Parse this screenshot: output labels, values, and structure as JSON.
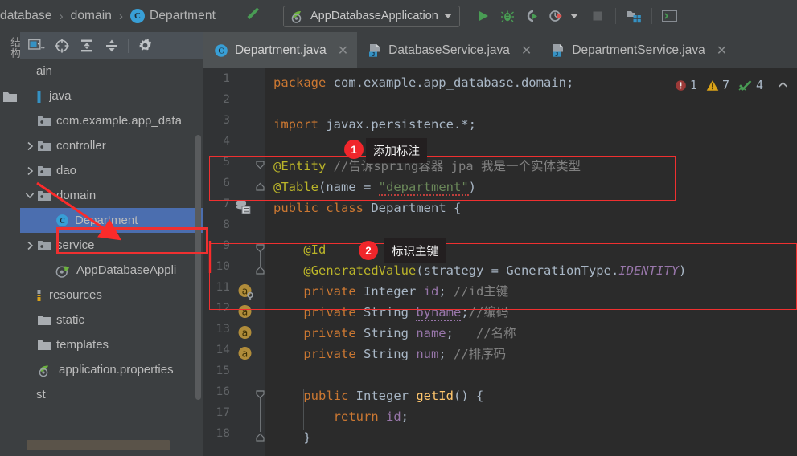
{
  "toolbar": {
    "breadcrumbs": [
      {
        "label": "database",
        "icon": "none"
      },
      {
        "label": "domain",
        "icon": "none"
      },
      {
        "label": "Department",
        "icon": "class-icon"
      }
    ],
    "separator": "›",
    "build_icon": "hammer-icon",
    "run_config": {
      "label": "AppDatabaseApplication",
      "icon": "spring-boot-icon"
    },
    "buttons": [
      {
        "name": "run-button",
        "icon": "play-icon"
      },
      {
        "name": "debug-button",
        "icon": "bug-icon"
      },
      {
        "name": "run-with-coverage-button",
        "icon": "coverage-icon"
      },
      {
        "name": "profiler-button",
        "icon": "profile-icon"
      },
      {
        "name": "stop-button",
        "icon": "stop-icon"
      },
      {
        "name": "project-structure-button",
        "icon": "project-structure-icon"
      },
      {
        "name": "terminal-button",
        "icon": "terminal-icon"
      }
    ]
  },
  "tool_window_tabs": {
    "structure_label": "结构",
    "project_icon": "folder-icon"
  },
  "project": {
    "toolbar_buttons": [
      {
        "name": "select-opened-file",
        "icon": "window-select-icon"
      },
      {
        "name": "locate-target",
        "icon": "crosshair-icon"
      },
      {
        "name": "expand-all",
        "icon": "expand-all-icon"
      },
      {
        "name": "collapse-all",
        "icon": "collapse-all-icon"
      },
      {
        "name": "settings",
        "icon": "gear-icon"
      }
    ],
    "tree": [
      {
        "label": "ain",
        "indent": 0,
        "twist": "",
        "icon": "none",
        "selected": false
      },
      {
        "label": "java",
        "indent": 0,
        "twist": "",
        "icon": "source-root-icon",
        "selected": false
      },
      {
        "label": "com.example.app_data",
        "indent": 1,
        "twist": "",
        "icon": "package-icon",
        "selected": false
      },
      {
        "label": "controller",
        "indent": 1,
        "twist": "right",
        "icon": "package-icon",
        "selected": false
      },
      {
        "label": "dao",
        "indent": 1,
        "twist": "right",
        "icon": "package-icon",
        "selected": false
      },
      {
        "label": "domain",
        "indent": 1,
        "twist": "down",
        "icon": "package-icon",
        "selected": false
      },
      {
        "label": "Department",
        "indent": 2,
        "twist": "",
        "icon": "class-icon",
        "selected": true
      },
      {
        "label": "service",
        "indent": 1,
        "twist": "right",
        "icon": "package-icon",
        "selected": false
      },
      {
        "label": "AppDatabaseAppli",
        "indent": 2,
        "twist": "",
        "icon": "spring-class-icon",
        "selected": false
      },
      {
        "label": "resources",
        "indent": 0,
        "twist": "",
        "icon": "resource-root-icon",
        "selected": false
      },
      {
        "label": "static",
        "indent": 1,
        "twist": "",
        "icon": "folder-icon",
        "selected": false
      },
      {
        "label": "templates",
        "indent": 1,
        "twist": "",
        "icon": "folder-icon",
        "selected": false
      },
      {
        "label": "application.properties",
        "indent": 1,
        "twist": "",
        "icon": "spring-prop-icon",
        "selected": false
      },
      {
        "label": "st",
        "indent": 0,
        "twist": "",
        "icon": "none",
        "selected": false
      }
    ]
  },
  "editor_tabs": [
    {
      "label": "Department.java",
      "icon": "class-icon",
      "active": true,
      "close": "✕"
    },
    {
      "label": "DatabaseService.java",
      "icon": "java-icon",
      "active": false,
      "close": "✕"
    },
    {
      "label": "DepartmentService.java",
      "icon": "java-icon",
      "active": false,
      "close": "✕"
    }
  ],
  "inspection_widget": {
    "error_icon": "error-icon",
    "error_count": "1",
    "warning_icon": "warning-icon",
    "warning_count": "7",
    "ok_icon": "inspections-ok-icon",
    "ok_count": "4",
    "collapse_icon": "chevron-up-icon"
  },
  "code": {
    "lines": [
      {
        "num": "1",
        "gutter": "",
        "fold": "",
        "tokens": [
          {
            "t": "package ",
            "c": "k"
          },
          {
            "t": "com.example.app_database.domain;",
            "c": "p"
          }
        ]
      },
      {
        "num": "2",
        "gutter": "",
        "fold": "",
        "tokens": []
      },
      {
        "num": "3",
        "gutter": "",
        "fold": "",
        "tokens": [
          {
            "t": "import ",
            "c": "k"
          },
          {
            "t": "javax.persistence.*;",
            "c": "p"
          }
        ]
      },
      {
        "num": "4",
        "gutter": "",
        "fold": "",
        "tokens": []
      },
      {
        "num": "5",
        "gutter": "",
        "fold": "collapse",
        "tokens": [
          {
            "t": "@Entity ",
            "c": "an"
          },
          {
            "t": "//告诉spring容器 jpa 我是一个实体类型",
            "c": "c"
          }
        ]
      },
      {
        "num": "6",
        "gutter": "",
        "fold": "end",
        "tokens": [
          {
            "t": "@Table",
            "c": "an"
          },
          {
            "t": "(",
            "c": "p"
          },
          {
            "t": "name",
            "c": "p"
          },
          {
            "t": " = ",
            "c": "p"
          },
          {
            "t": "\"department\"",
            "c": "s-sq"
          },
          {
            "t": ")",
            "c": "p"
          }
        ]
      },
      {
        "num": "7",
        "gutter": "database-icon",
        "fold": "",
        "tokens": [
          {
            "t": "public class ",
            "c": "k"
          },
          {
            "t": "Department",
            "c": "p"
          },
          {
            "t": " {",
            "c": "p"
          }
        ]
      },
      {
        "num": "8",
        "gutter": "",
        "fold": "",
        "tokens": []
      },
      {
        "num": "9",
        "gutter": "",
        "fold": "collapse",
        "tokens": [
          {
            "t": "    @Id",
            "c": "an"
          }
        ]
      },
      {
        "num": "10",
        "gutter": "",
        "fold": "end",
        "tokens": [
          {
            "t": "    @GeneratedValue",
            "c": "an"
          },
          {
            "t": "(",
            "c": "p"
          },
          {
            "t": "strategy",
            "c": "p"
          },
          {
            "t": " = ",
            "c": "p"
          },
          {
            "t": "GenerationType.",
            "c": "p"
          },
          {
            "t": "IDENTITY",
            "c": "f"
          },
          {
            "t": ")",
            "c": "p"
          }
        ]
      },
      {
        "num": "11",
        "gutter": "annotation-key-icon",
        "fold": "",
        "tokens": [
          {
            "t": "    private ",
            "c": "k"
          },
          {
            "t": "Integer ",
            "c": "p"
          },
          {
            "t": "id",
            "c": "fld"
          },
          {
            "t": "; ",
            "c": "p"
          },
          {
            "t": "//id主键",
            "c": "c"
          }
        ]
      },
      {
        "num": "12",
        "gutter": "annotation-icon",
        "fold": "",
        "tokens": [
          {
            "t": "    private ",
            "c": "k"
          },
          {
            "t": "String ",
            "c": "p"
          },
          {
            "t": "byname",
            "c": "fld-sq"
          },
          {
            "t": ";",
            "c": "p"
          },
          {
            "t": "//编码",
            "c": "c"
          }
        ]
      },
      {
        "num": "13",
        "gutter": "annotation-icon",
        "fold": "",
        "tokens": [
          {
            "t": "    private ",
            "c": "k"
          },
          {
            "t": "String ",
            "c": "p"
          },
          {
            "t": "name",
            "c": "fld"
          },
          {
            "t": ";   ",
            "c": "p"
          },
          {
            "t": "//名称",
            "c": "c"
          }
        ]
      },
      {
        "num": "14",
        "gutter": "annotation-icon",
        "fold": "",
        "tokens": [
          {
            "t": "    private ",
            "c": "k"
          },
          {
            "t": "String ",
            "c": "p"
          },
          {
            "t": "num",
            "c": "fld"
          },
          {
            "t": "; ",
            "c": "p"
          },
          {
            "t": "//排序码",
            "c": "c"
          }
        ]
      },
      {
        "num": "15",
        "gutter": "",
        "fold": "",
        "tokens": []
      },
      {
        "num": "16",
        "gutter": "",
        "fold": "collapse",
        "tokens": [
          {
            "t": "    public ",
            "c": "k"
          },
          {
            "t": "Integer ",
            "c": "p"
          },
          {
            "t": "getId",
            "c": "m"
          },
          {
            "t": "() {",
            "c": "p"
          }
        ]
      },
      {
        "num": "17",
        "gutter": "",
        "fold": "",
        "tokens": [
          {
            "t": "        return ",
            "c": "k"
          },
          {
            "t": "id",
            "c": "fld"
          },
          {
            "t": ";",
            "c": "p"
          }
        ]
      },
      {
        "num": "18",
        "gutter": "",
        "fold": "end",
        "tokens": [
          {
            "t": "    }",
            "c": "p"
          }
        ]
      }
    ]
  },
  "annotations": [
    {
      "number": "1",
      "tip": "添加标注",
      "name": "annotation-callout-1"
    },
    {
      "number": "2",
      "tip": "标识主键",
      "name": "annotation-callout-2"
    }
  ],
  "colors": {
    "accent_red": "#f0262b",
    "selection_blue": "#4b6eaf",
    "editor_bg": "#2b2b2b",
    "chrome_bg": "#3c3f41"
  }
}
